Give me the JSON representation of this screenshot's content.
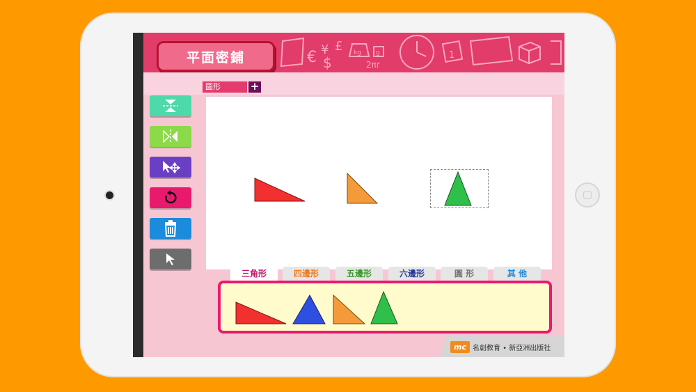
{
  "app": {
    "title": "平面密鋪",
    "shape_tag": "圖形",
    "add_label": "+"
  },
  "tools": [
    {
      "name": "flip-vertical",
      "color": "#4DD9A9"
    },
    {
      "name": "flip-horizontal",
      "color": "#8CD94A"
    },
    {
      "name": "move",
      "color": "#6A3FC4"
    },
    {
      "name": "rotate",
      "color": "#E91A6E"
    },
    {
      "name": "delete",
      "color": "#1B8BDB"
    },
    {
      "name": "select",
      "color": "#6D6D6D"
    }
  ],
  "tabs": [
    {
      "label": "三角形",
      "color": "#C0106A",
      "active": true
    },
    {
      "label": "四邊形",
      "color": "#F07B1E",
      "active": false
    },
    {
      "label": "五邊形",
      "color": "#3A9A2A",
      "active": false
    },
    {
      "label": "六邊形",
      "color": "#2A3A9A",
      "active": false
    },
    {
      "label": "圓 形",
      "color": "#777777",
      "active": false
    },
    {
      "label": "其 他",
      "color": "#1B8BDB",
      "active": false
    }
  ],
  "canvas_shapes": [
    {
      "name": "red-triangle",
      "color": "#F2302F"
    },
    {
      "name": "orange-triangle",
      "color": "#F59A3A"
    },
    {
      "name": "green-triangle",
      "color": "#2FBF4A",
      "selected": true
    }
  ],
  "palette_shapes": [
    {
      "name": "red-triangle",
      "color": "#F2302F"
    },
    {
      "name": "blue-triangle",
      "color": "#2E4FE0"
    },
    {
      "name": "orange-triangle",
      "color": "#F59A3A"
    },
    {
      "name": "green-triangle",
      "color": "#2FBF4A"
    }
  ],
  "footer": {
    "logo": "mc",
    "publisher": "名創教育 • 新亞洲出版社"
  },
  "header_doodles": {
    "pi_label": "2πr",
    "kg_label": "kg",
    "g_label": "g",
    "calendar_label": "1"
  }
}
